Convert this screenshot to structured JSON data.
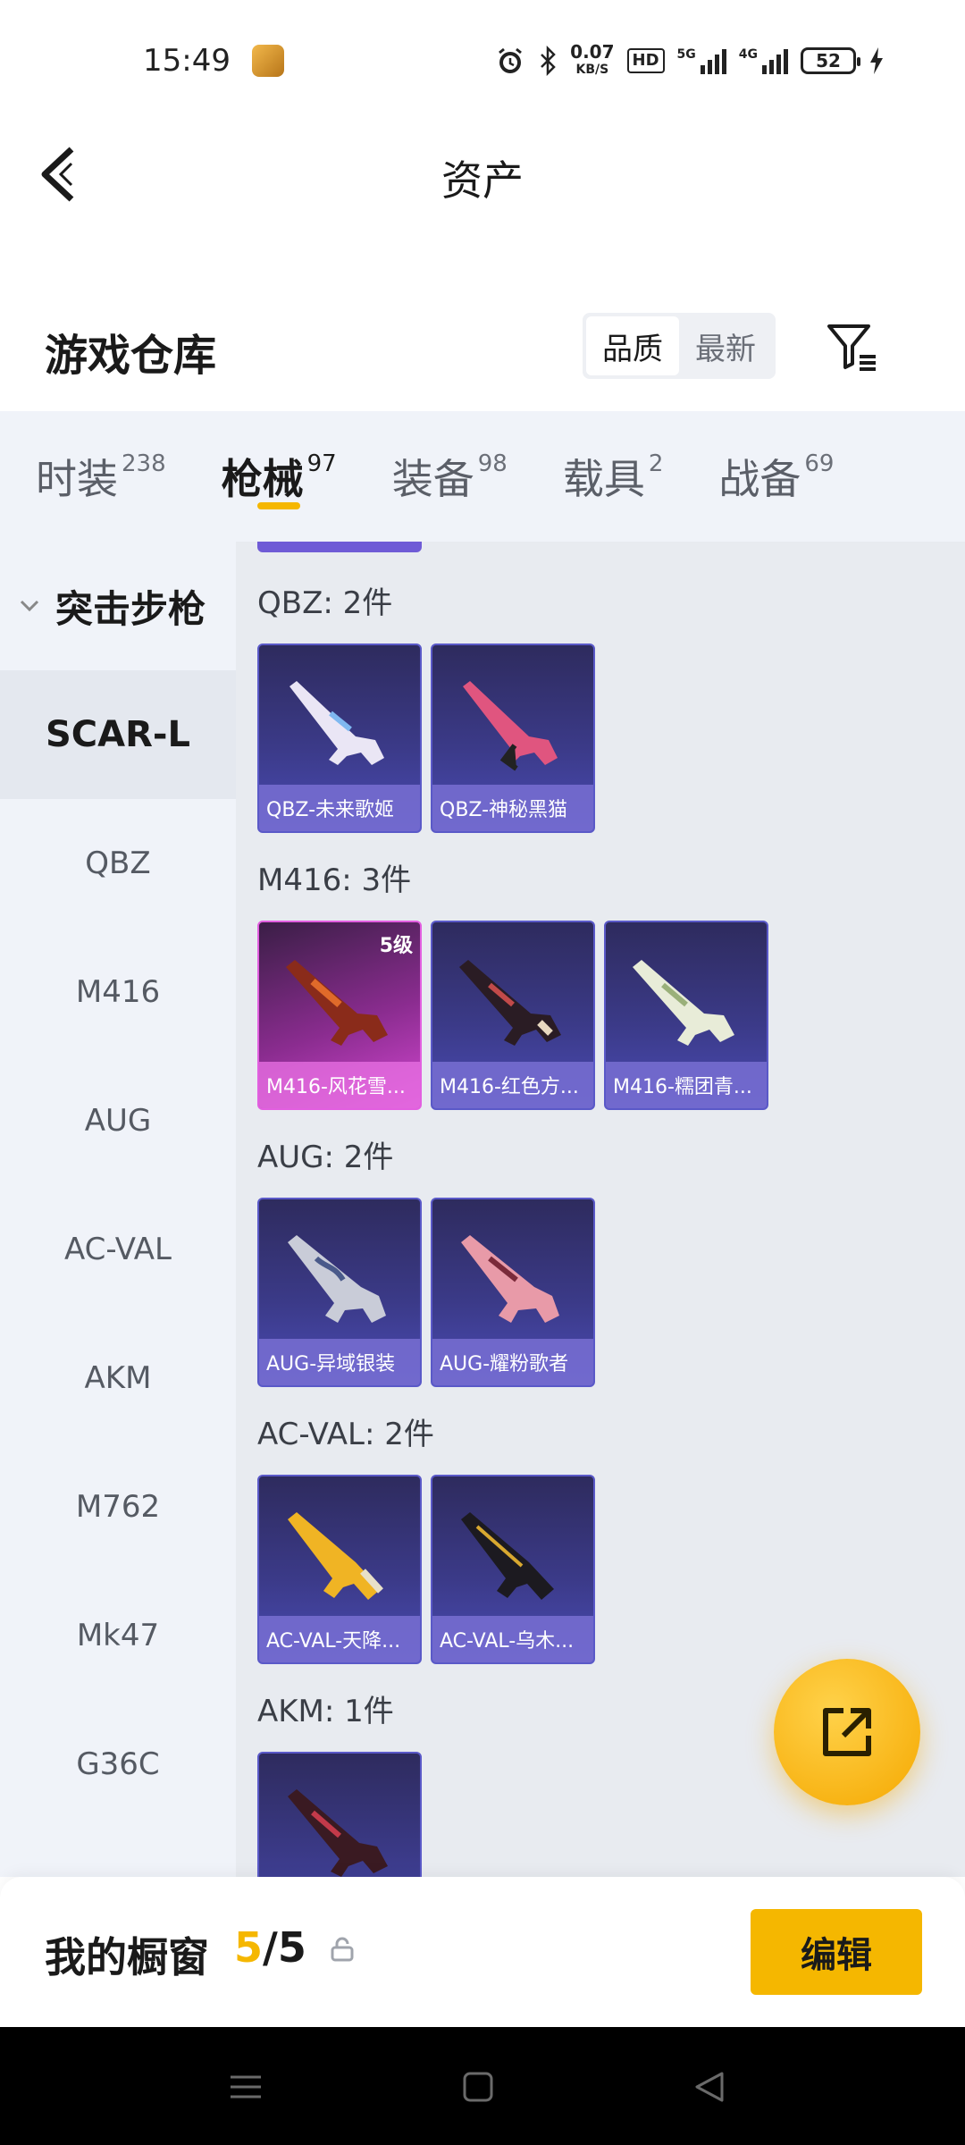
{
  "status": {
    "time": "15:49",
    "net_speed": "0.07",
    "net_unit": "KB/S",
    "hd": "HD",
    "sig1": "5G",
    "sig2": "4G",
    "battery": "52"
  },
  "header": {
    "title": "资产"
  },
  "warehouse": {
    "title": "游戏仓库",
    "sort_options": [
      "品质",
      "最新"
    ]
  },
  "tabs": [
    {
      "label": "时装",
      "count": "238"
    },
    {
      "label": "枪械",
      "count": "97"
    },
    {
      "label": "装备",
      "count": "98"
    },
    {
      "label": "载具",
      "count": "2"
    },
    {
      "label": "战备",
      "count": "69"
    }
  ],
  "sidenav": {
    "group": "突击步枪",
    "items": [
      "SCAR-L",
      "QBZ",
      "M416",
      "AUG",
      "AC-VAL",
      "AKM",
      "M762",
      "Mk47",
      "G36C"
    ]
  },
  "sections": [
    {
      "title": "QBZ: 2件",
      "items": [
        {
          "name": "QBZ-未来歌姬"
        },
        {
          "name": "QBZ-神秘黑猫"
        }
      ]
    },
    {
      "title": "M416: 3件",
      "items": [
        {
          "name": "M416-风花雪...",
          "badge": "5级"
        },
        {
          "name": "M416-红色方..."
        },
        {
          "name": "M416-糯团青..."
        }
      ]
    },
    {
      "title": "AUG: 2件",
      "items": [
        {
          "name": "AUG-异域银装"
        },
        {
          "name": "AUG-耀粉歌者"
        }
      ]
    },
    {
      "title": "AC-VAL: 2件",
      "items": [
        {
          "name": "AC-VAL-天降..."
        },
        {
          "name": "AC-VAL-乌木..."
        }
      ]
    },
    {
      "title": "AKM: 1件",
      "items": [
        {
          "name": ""
        }
      ]
    }
  ],
  "showcase": {
    "label": "我的橱窗",
    "count_current": "5",
    "count_sep": "/",
    "count_total": "5",
    "edit_label": "编辑"
  },
  "colors": {
    "accent": "#f5b700",
    "card_purple": "#3b3a88",
    "card_legend": "#d247d0"
  }
}
